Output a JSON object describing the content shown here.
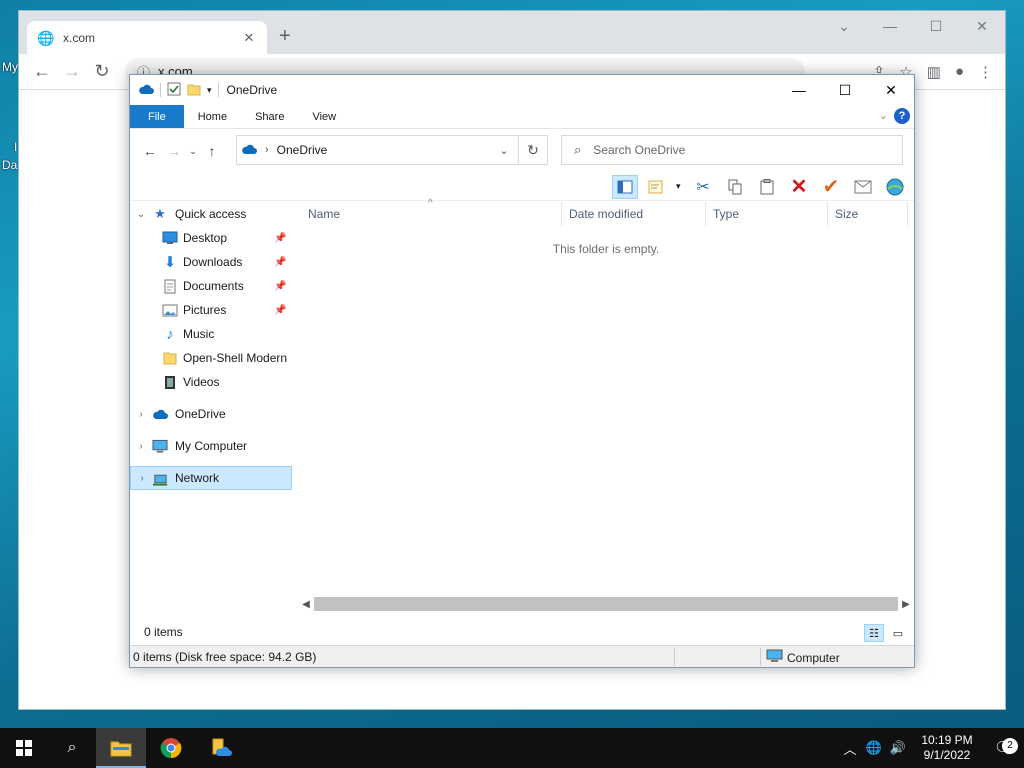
{
  "desktop": {
    "partial_label_1": "My",
    "partial_label_2": "I",
    "partial_label_3": "Da"
  },
  "chrome": {
    "tab_title": "x.com",
    "omnibox_text": "x.com"
  },
  "explorer": {
    "title": "OneDrive",
    "ribbon_tabs": [
      "File",
      "Home",
      "Share",
      "View"
    ],
    "address_path": "OneDrive",
    "search_placeholder": "Search OneDrive",
    "columns": [
      "Name",
      "Date modified",
      "Type",
      "Size"
    ],
    "empty_message": "This folder is empty.",
    "nav": {
      "quick_access": "Quick access",
      "items": [
        {
          "label": "Desktop",
          "icon": "desktop-icon",
          "pinned": true
        },
        {
          "label": "Downloads",
          "icon": "download-icon",
          "pinned": true
        },
        {
          "label": "Documents",
          "icon": "document-icon",
          "pinned": true
        },
        {
          "label": "Pictures",
          "icon": "picture-icon",
          "pinned": true
        },
        {
          "label": "Music",
          "icon": "music-icon",
          "pinned": false
        },
        {
          "label": "Open-Shell Modern",
          "icon": "folder-icon",
          "pinned": false
        },
        {
          "label": "Videos",
          "icon": "video-icon",
          "pinned": false
        }
      ],
      "onedrive": "OneDrive",
      "my_computer": "My Computer",
      "network": "Network"
    },
    "status_items": "0 items",
    "classic_status_left": "0 items (Disk free space: 94.2 GB)",
    "classic_status_right": "Computer"
  },
  "taskbar": {
    "time": "10:19 PM",
    "date": "9/1/2022",
    "notification_count": "2"
  },
  "colors": {
    "file_tab": "#1979ca",
    "selection": "#cce8ff",
    "selection_border": "#99d1ff",
    "onedrive_blue": "#0f6cbd"
  }
}
